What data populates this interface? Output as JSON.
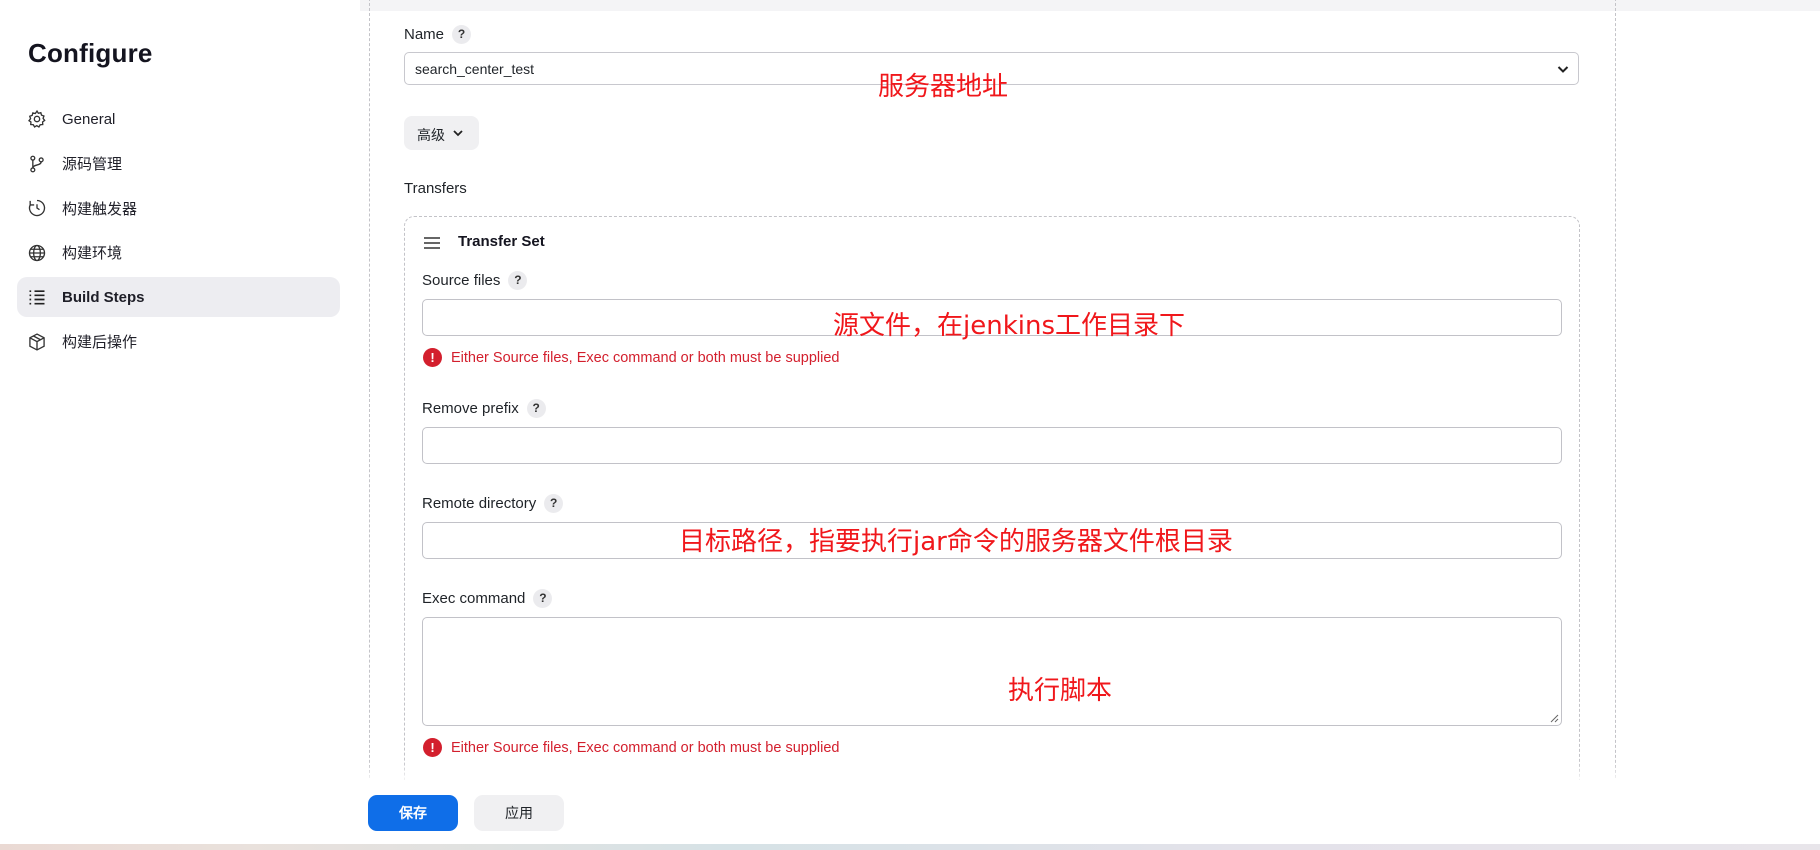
{
  "sidebar": {
    "title": "Configure",
    "items": [
      {
        "label": "General",
        "icon": "gear-icon"
      },
      {
        "label": "源码管理",
        "icon": "branch-icon"
      },
      {
        "label": "构建触发器",
        "icon": "clock-icon"
      },
      {
        "label": "构建环境",
        "icon": "globe-icon"
      },
      {
        "label": "Build Steps",
        "icon": "list-icon",
        "active": true
      },
      {
        "label": "构建后操作",
        "icon": "package-icon"
      }
    ]
  },
  "server": {
    "name_label": "Name",
    "help": "?",
    "selected": "search_center_test",
    "advanced_label": "高级",
    "transfers_label": "Transfers"
  },
  "transfer_set": {
    "title": "Transfer Set",
    "source_files_label": "Source files",
    "source_files_value": "",
    "remove_prefix_label": "Remove prefix",
    "remove_prefix_value": "",
    "remote_directory_label": "Remote directory",
    "remote_directory_value": "",
    "exec_command_label": "Exec command",
    "exec_command_value": "",
    "error_icon": "!",
    "error_text": "Either Source files, Exec command or both must be supplied"
  },
  "annotations": {
    "server_address": "服务器地址",
    "source_files": "源文件，在jenkins工作目录下",
    "remote_directory": "目标路径，指要执行jar命令的服务器文件根目录",
    "exec_command": "执行脚本"
  },
  "buttons": {
    "save": "保存",
    "apply": "应用"
  },
  "colors": {
    "accent": "#0f6ee8",
    "error": "#d31f2d",
    "annotation": "#f0171b",
    "active_nav_bg": "#ededf1"
  }
}
